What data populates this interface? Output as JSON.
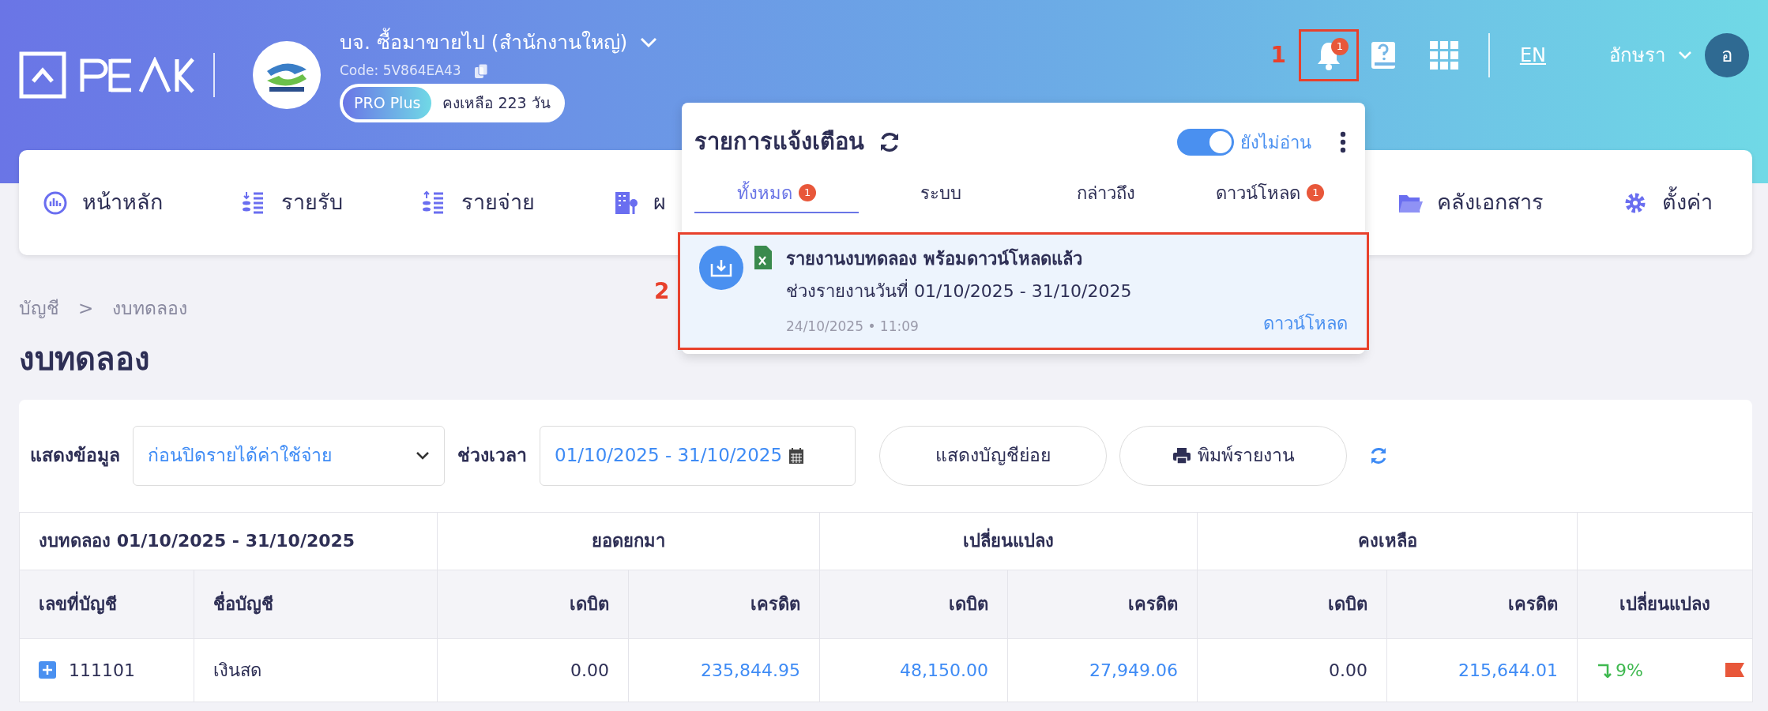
{
  "header": {
    "company_name": "บจ. ซื้อมาขายไป (สำนักงานใหญ่)",
    "company_code": "Code: 5V864EA43",
    "plan_badge": "PRO Plus",
    "plan_remaining": "คงเหลือ 223 วัน",
    "notification_count": "1",
    "language": "EN",
    "user_name": "อักษรา",
    "avatar_letter": "อ"
  },
  "annotations": [
    {
      "label": "1"
    },
    {
      "label": "2"
    }
  ],
  "nav": {
    "items": [
      {
        "label": "หน้าหลัก"
      },
      {
        "label": "รายรับ"
      },
      {
        "label": "รายจ่าย"
      },
      {
        "label": "ผ"
      },
      {
        "label": "คลังเอกสาร"
      },
      {
        "label": "ตั้งค่า"
      }
    ]
  },
  "notifications": {
    "title": "รายการแจ้งเตือน",
    "unread_toggle": {
      "label": "ยังไม่อ่าน",
      "on": true
    },
    "tabs": [
      {
        "label": "ทั้งหมด",
        "count": "1",
        "selected": true
      },
      {
        "label": "ระบบ",
        "selected": false
      },
      {
        "label": "กล่าวถึง",
        "selected": false
      },
      {
        "label": "ดาวน์โหลด",
        "count": "1",
        "selected": false
      }
    ],
    "items": [
      {
        "title": "รายงานงบทดลอง พร้อมดาวน์โหลดแล้ว",
        "subtitle": "ช่วงรายงานวันที่ 01/10/2025 - 31/10/2025",
        "time": "24/10/2025 • 11:09",
        "action": "ดาวน์โหลด"
      }
    ]
  },
  "breadcrumb": [
    "บัญชี",
    ">",
    "งบทดลอง"
  ],
  "page_title": "งบทดลอง",
  "filters": {
    "display_label": "แสดงข้อมูล",
    "display_value": "ก่อนปิดรายได้ค่าใช้จ่าย",
    "period_label": "ช่วงเวลา",
    "period_value": "01/10/2025 - 31/10/2025",
    "buttons": [
      {
        "label": "แสดงบัญชีย่อย",
        "kind": "plain"
      },
      {
        "label": "พิมพ์รายงาน",
        "kind": "print"
      }
    ]
  },
  "table": {
    "title": "งบทดลอง 01/10/2025 - 31/10/2025",
    "groups": [
      "ยอดยกมา",
      "เปลี่ยนแปลง",
      "คงเหลือ"
    ],
    "columns": [
      "เลขที่บัญชี",
      "ชื่อบัญชี",
      "เดบิต",
      "เครดิต",
      "เดบิต",
      "เครดิต",
      "เดบิต",
      "เครดิต",
      "เปลี่ยนแปลง"
    ],
    "rows": [
      {
        "account": "111101",
        "name": "เงินสด",
        "change": "9%",
        "values": [
          {
            "value": "0.00",
            "link": false
          },
          {
            "value": "235,844.95",
            "link": true
          },
          {
            "value": "48,150.00",
            "link": true
          },
          {
            "value": "27,949.06",
            "link": true
          },
          {
            "value": "0.00",
            "link": false
          },
          {
            "value": "215,644.01",
            "link": true
          }
        ]
      }
    ]
  }
}
